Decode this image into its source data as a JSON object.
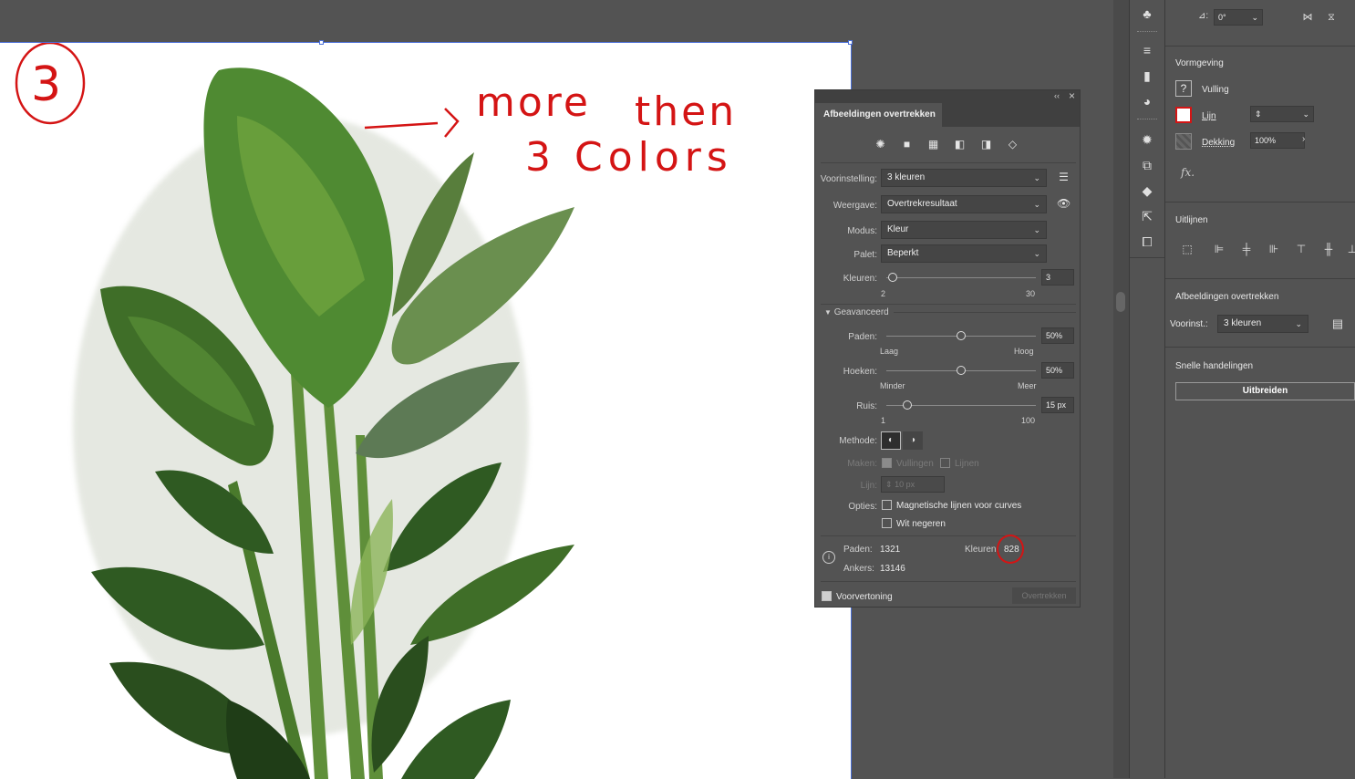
{
  "annotation": {
    "number": "3",
    "text_line1a": "more",
    "text_line1b": "then",
    "text_line2": "3 Colors"
  },
  "panel": {
    "title": "Afbeeldingen overtrekken",
    "collapse_glyph": "‹‹",
    "close_glyph": "×",
    "presets_icons": [
      "auto-color-icon",
      "high-color-icon",
      "low-color-icon",
      "grayscale-icon",
      "black-white-icon",
      "outline-icon"
    ],
    "voorinstelling_label": "Voorinstelling:",
    "voorinstelling_value": "3 kleuren",
    "weergave_label": "Weergave:",
    "weergave_value": "Overtrekresultaat",
    "modus_label": "Modus:",
    "modus_value": "Kleur",
    "palet_label": "Palet:",
    "palet_value": "Beperkt",
    "kleuren_label": "Kleuren:",
    "kleuren_value": "3",
    "kleuren_min": "2",
    "kleuren_max": "30",
    "kleuren_slider": 0.04,
    "advanced_label": "Geavanceerd",
    "paden_label": "Paden:",
    "paden_value": "50%",
    "paden_min": "Laag",
    "paden_max": "Hoog",
    "paden_slider": 0.5,
    "hoeken_label": "Hoeken:",
    "hoeken_value": "50%",
    "hoeken_min": "Minder",
    "hoeken_max": "Meer",
    "hoeken_slider": 0.5,
    "ruis_label": "Ruis:",
    "ruis_value": "15 px",
    "ruis_min": "1",
    "ruis_max": "100",
    "ruis_slider": 0.14,
    "methode_label": "Methode:",
    "maken_label": "Maken:",
    "maken_vullingen": "Vullingen",
    "maken_lijnen": "Lijnen",
    "lijn_label": "Lijn:",
    "lijn_value": "10 px",
    "opties_label": "Opties:",
    "opt_magnetisch": "Magnetische lijnen voor curves",
    "opt_wit": "Wit negeren",
    "stat_paden_label": "Paden:",
    "stat_paden": "1321",
    "stat_kleuren_label": "Kleuren:",
    "stat_kleuren": "828",
    "stat_ankers_label": "Ankers:",
    "stat_ankers": "13146",
    "voorvertoning": "Voorvertoning",
    "overtrekken_button": "Overtrekken"
  },
  "props": {
    "angle_icon": "⊿:",
    "angle_value": "0°",
    "vormgeving": "Vormgeving",
    "vulling": "Vulling",
    "lijn": "Lijn",
    "dekking": "Dekking",
    "dekking_value": "100%",
    "fx": "fx.",
    "uitlijnen": "Uitlijnen",
    "afbeeldingen_overtrekken": "Afbeeldingen overtrekken",
    "voorinst_label": "Voorinst.:",
    "voorinst_value": "3 kleuren",
    "snelle": "Snelle handelingen",
    "uitbreiden": "Uitbreiden"
  },
  "colors": {
    "annotation_red": "#d41414",
    "panel_bg": "#535353",
    "plant_dark": "#2f5a22",
    "plant_mid": "#4f8a32",
    "plant_light": "#8cb45a"
  }
}
